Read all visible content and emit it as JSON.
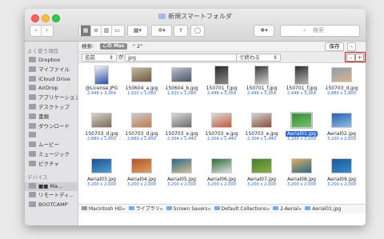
{
  "window": {
    "title": "新規スマートフォルダ"
  },
  "toolbar": {
    "search_placeholder": "検索"
  },
  "sidebar": {
    "favorites_header": "よく使う項目",
    "favorites": [
      {
        "label": "Dropbox",
        "icon": "folder-icon"
      },
      {
        "label": "マイファイル",
        "icon": "all-files-icon"
      },
      {
        "label": "iCloud Drive",
        "icon": "cloud-icon"
      },
      {
        "label": "AirDrop",
        "icon": "airdrop-icon"
      },
      {
        "label": "アプリケーション",
        "icon": "applications-icon"
      },
      {
        "label": "デスクトップ",
        "icon": "desktop-icon"
      },
      {
        "label": "書類",
        "icon": "documents-icon"
      },
      {
        "label": "ダウンロード",
        "icon": "downloads-icon"
      },
      {
        "label": "",
        "icon": "home-icon"
      },
      {
        "label": "ムービー",
        "icon": "movies-icon"
      },
      {
        "label": "ミュージック",
        "icon": "music-icon"
      },
      {
        "label": "ピクチャ",
        "icon": "pictures-icon"
      }
    ],
    "devices_header": "デバイス",
    "devices": [
      {
        "label": "■■ Ma...",
        "icon": "hard-drive-icon"
      },
      {
        "label": "リモートディ...",
        "icon": "remote-disc-icon"
      },
      {
        "label": "BOOTCAMP",
        "icon": "hard-drive-icon"
      }
    ]
  },
  "query": {
    "label": "検索:",
    "scope": "この Mac",
    "text": "\"           2\"",
    "save": "保存",
    "remove": "–"
  },
  "rule": {
    "attribute": "名前",
    "connector": "が",
    "value": "jpg",
    "operator": "で終わる",
    "remove": "–",
    "add": "+"
  },
  "files": [
    {
      "name": "@License.JPG",
      "dim": "2,448 x 3,264",
      "tall": true,
      "colors": [
        "#f2f2f2",
        "#2b4fa8"
      ]
    },
    {
      "name": "150604_a.jpg",
      "dim": "1,920 x 1,080",
      "tall": false,
      "colors": [
        "#c2b89c",
        "#6b5a45"
      ]
    },
    {
      "name": "150604_b.jpg",
      "dim": "1,920 x 1,080",
      "tall": false,
      "colors": [
        "#b8c0cc",
        "#4d5566"
      ]
    },
    {
      "name": "150701_f.jpg",
      "dim": "2,448 x 3,264",
      "tall": true,
      "colors": [
        "#2a2a2a",
        "#8a8a8a"
      ]
    },
    {
      "name": "150701_f.jpg",
      "dim": "2,448 x 3,264",
      "tall": true,
      "colors": [
        "#3a3a3a",
        "#cfcfcf"
      ]
    },
    {
      "name": "150701_f.jpg",
      "dim": "2,448 x 3,264",
      "tall": true,
      "colors": [
        "#2e2e2e",
        "#b5b5b5"
      ]
    },
    {
      "name": "150703_d.jpg",
      "dim": "2,880 x 1,800",
      "tall": false,
      "colors": [
        "#8e9cb5",
        "#d9b48a"
      ]
    },
    {
      "name": "150703_d.jpg",
      "dim": "2,880 x 1,800",
      "tall": false,
      "colors": [
        "#d5d0c8",
        "#7a6a55"
      ]
    },
    {
      "name": "150703_d.jpg",
      "dim": "2,880 x 1,800",
      "tall": false,
      "colors": [
        "#c9c9d0",
        "#c47a4a"
      ]
    },
    {
      "name": "150703_e.jpg",
      "dim": "2,304 x 1,440",
      "tall": false,
      "colors": [
        "#d8d8d8",
        "#6c6c6c"
      ]
    },
    {
      "name": "150703_e.jpg",
      "dim": "2,304 x 1,440",
      "tall": false,
      "colors": [
        "#dadada",
        "#c25a3a"
      ]
    },
    {
      "name": "150703_e.jpg",
      "dim": "2,304 x 1,440",
      "tall": false,
      "colors": [
        "#d2d2d2",
        "#8b4b3a"
      ]
    },
    {
      "name": "Aerial01.jpg",
      "dim": "3,200 x 2,000",
      "tall": false,
      "selected": true,
      "colors": [
        "#2f8f3a",
        "#7ec06a"
      ]
    },
    {
      "name": "Aerial02.jpg",
      "dim": "3,200 x 2,000",
      "tall": false,
      "colors": [
        "#2a5fb0",
        "#8fc0e8"
      ]
    },
    {
      "name": "Aerial03.jpg",
      "dim": "3,200 x 2,000",
      "tall": false,
      "colors": [
        "#1e4e8c",
        "#4fa0d8"
      ]
    },
    {
      "name": "Aerial04.jpg",
      "dim": "3,200 x 2,000",
      "tall": false,
      "colors": [
        "#b0542a",
        "#e0a060"
      ]
    },
    {
      "name": "Aerial05.jpg",
      "dim": "3,200 x 2,000",
      "tall": false,
      "colors": [
        "#2c6a8c",
        "#d0c090"
      ]
    },
    {
      "name": "Aerial06.jpg",
      "dim": "3,200 x 2,000",
      "tall": false,
      "colors": [
        "#2b6e3a",
        "#e0e0e0"
      ]
    },
    {
      "name": "Aerial07.jpg",
      "dim": "3,200 x 2,000",
      "tall": false,
      "colors": [
        "#4a7a2a",
        "#8ab04a"
      ]
    },
    {
      "name": "Aerial08.jpg",
      "dim": "3,200 x 2,000",
      "tall": false,
      "colors": [
        "#d8b060",
        "#2a6a8a"
      ]
    },
    {
      "name": "Aerial09.jpg",
      "dim": "3,200 x 2,000",
      "tall": false,
      "colors": [
        "#1a5a9a",
        "#3a8ac8"
      ]
    }
  ],
  "path": {
    "segments": [
      {
        "label": "Macintosh HD",
        "icon": "hard-drive-icon"
      },
      {
        "label": "ライブラリ",
        "icon": "folder-icon"
      },
      {
        "label": "Screen Savers",
        "icon": "folder-icon"
      },
      {
        "label": "Default Collections",
        "icon": "folder-icon"
      },
      {
        "label": "2-Aerial",
        "icon": "folder-icon"
      },
      {
        "label": "Aerial01.jpg",
        "icon": "image-file-icon"
      }
    ]
  },
  "colors": {
    "selection": "#2a6ad3",
    "highlight_box": "#e0261b",
    "dimensions_text": "#2a6ad3"
  }
}
